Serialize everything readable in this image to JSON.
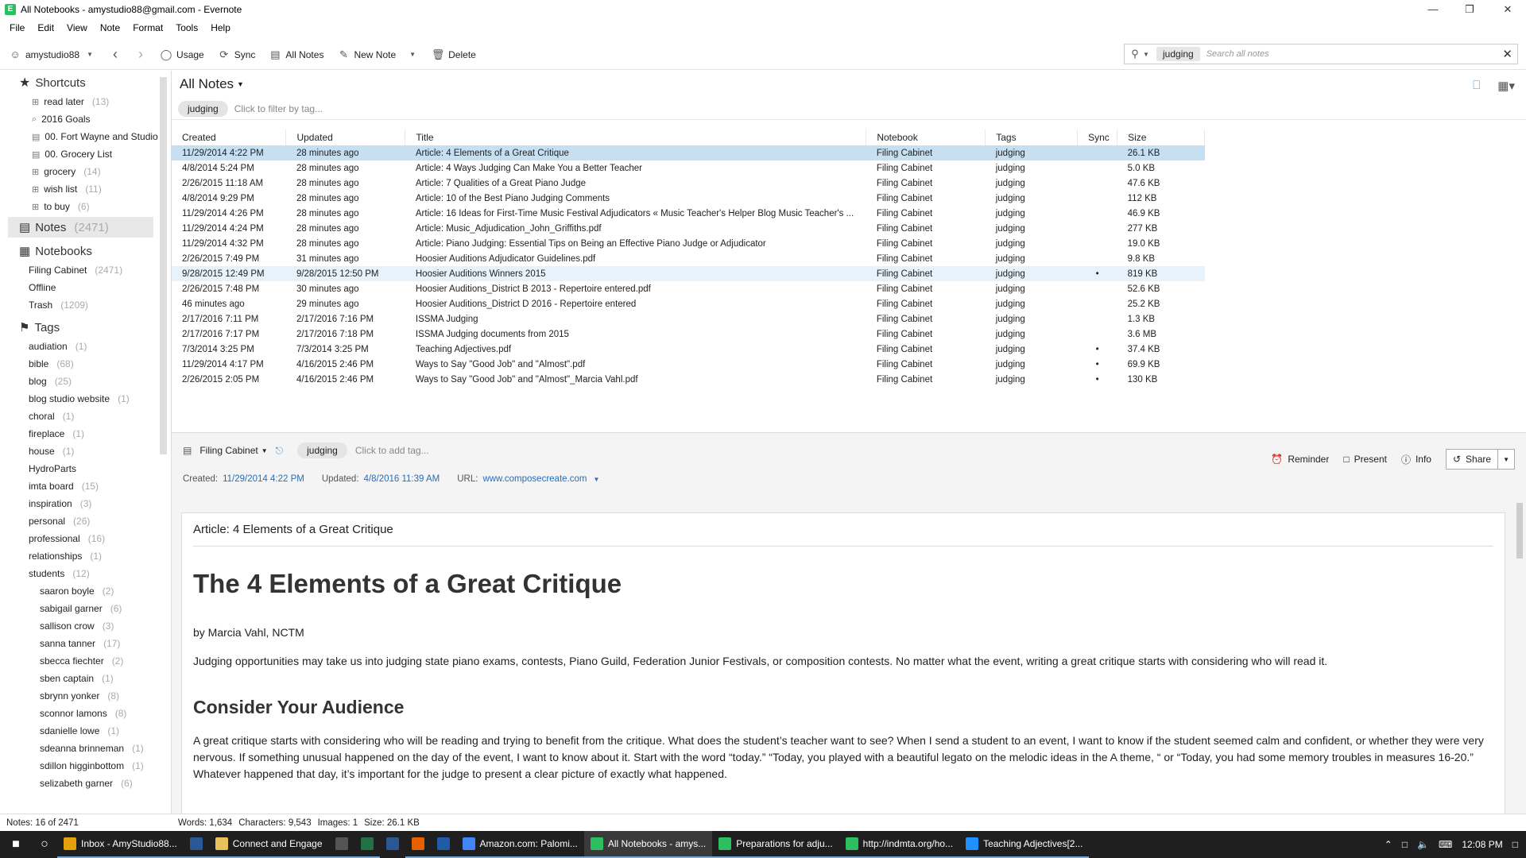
{
  "window": {
    "title": "All Notebooks - amystudio88@gmail.com - Evernote",
    "controls": [
      "minimize",
      "restore",
      "close"
    ]
  },
  "menu": [
    "File",
    "Edit",
    "View",
    "Note",
    "Format",
    "Tools",
    "Help"
  ],
  "toolbar": {
    "account": "amystudio88",
    "usage": "Usage",
    "sync": "Sync",
    "all_notes": "All Notes",
    "new_note": "New Note",
    "delete": "Delete",
    "search_token": "judging",
    "search_placeholder": "Search all notes"
  },
  "sidebar": {
    "shortcuts_label": "Shortcuts",
    "shortcuts": [
      {
        "label": "read later",
        "count": "(13)"
      },
      {
        "label": "2016 Goals",
        "count": ""
      },
      {
        "label": "00. Fort Wayne and Studio",
        "count": ""
      },
      {
        "label": "00. Grocery List",
        "count": ""
      },
      {
        "label": "grocery",
        "count": "(14)"
      },
      {
        "label": "wish list",
        "count": "(11)"
      },
      {
        "label": "to buy",
        "count": "(6)"
      }
    ],
    "notes_label": "Notes",
    "notes_count": "(2471)",
    "notebooks_label": "Notebooks",
    "notebooks": [
      {
        "label": "Filing Cabinet",
        "count": "(2471)"
      },
      {
        "label": "Offline",
        "count": ""
      },
      {
        "label": "Trash",
        "count": "(1209)"
      }
    ],
    "tags_label": "Tags",
    "tags": [
      {
        "label": "audiation",
        "count": "(1)"
      },
      {
        "label": "bible",
        "count": "(68)"
      },
      {
        "label": "blog",
        "count": "(25)"
      },
      {
        "label": "blog studio website",
        "count": "(1)"
      },
      {
        "label": "choral",
        "count": "(1)"
      },
      {
        "label": "fireplace",
        "count": "(1)"
      },
      {
        "label": "house",
        "count": "(1)"
      },
      {
        "label": "HydroParts",
        "count": ""
      },
      {
        "label": "imta board",
        "count": "(15)"
      },
      {
        "label": "inspiration",
        "count": "(3)"
      },
      {
        "label": "personal",
        "count": "(26)"
      },
      {
        "label": "professional",
        "count": "(16)"
      },
      {
        "label": "relationships",
        "count": "(1)"
      },
      {
        "label": "students",
        "count": "(12)"
      }
    ],
    "student_tags": [
      {
        "label": "saaron boyle",
        "count": "(2)"
      },
      {
        "label": "sabigail garner",
        "count": "(6)"
      },
      {
        "label": "sallison crow",
        "count": "(3)"
      },
      {
        "label": "sanna tanner",
        "count": "(17)"
      },
      {
        "label": "sbecca fiechter",
        "count": "(2)"
      },
      {
        "label": "sben captain",
        "count": "(1)"
      },
      {
        "label": "sbrynn yonker",
        "count": "(8)"
      },
      {
        "label": "sconnor lamons",
        "count": "(8)"
      },
      {
        "label": "sdanielle lowe",
        "count": "(1)"
      },
      {
        "label": "sdeanna brinneman",
        "count": "(1)"
      },
      {
        "label": "sdillon higginbottom",
        "count": "(1)"
      },
      {
        "label": "selizabeth garner",
        "count": "(6)"
      }
    ]
  },
  "notelist": {
    "title": "All Notes",
    "filter_chip": "judging",
    "filter_hint": "Click to filter by tag...",
    "columns": [
      "Created",
      "Updated",
      "Title",
      "Notebook",
      "Tags",
      "Sync",
      "Size"
    ],
    "rows": [
      [
        "11/29/2014 4:22 PM",
        "28 minutes ago",
        "Article: 4 Elements of a Great Critique",
        "Filing Cabinet",
        "judging",
        "",
        "26.1 KB"
      ],
      [
        "4/8/2014 5:24 PM",
        "28 minutes ago",
        "Article: 4 Ways Judging Can Make You a Better Teacher",
        "Filing Cabinet",
        "judging",
        "",
        "5.0 KB"
      ],
      [
        "2/26/2015 11:18 AM",
        "28 minutes ago",
        "Article: 7 Qualities of a Great Piano Judge",
        "Filing Cabinet",
        "judging",
        "",
        "47.6 KB"
      ],
      [
        "4/8/2014 9:29 PM",
        "28 minutes ago",
        "Article: 10 of the Best Piano Judging Comments",
        "Filing Cabinet",
        "judging",
        "",
        "112 KB"
      ],
      [
        "11/29/2014 4:26 PM",
        "28 minutes ago",
        "Article: 16 Ideas for First-Time Music Festival Adjudicators « Music Teacher's Helper Blog Music Teacher's ...",
        "Filing Cabinet",
        "judging",
        "",
        "46.9 KB"
      ],
      [
        "11/29/2014 4:24 PM",
        "28 minutes ago",
        "Article: Music_Adjudication_John_Griffiths.pdf",
        "Filing Cabinet",
        "judging",
        "",
        "277 KB"
      ],
      [
        "11/29/2014 4:32 PM",
        "28 minutes ago",
        "Article: Piano Judging: Essential Tips on Being an Effective Piano Judge or Adjudicator",
        "Filing Cabinet",
        "judging",
        "",
        "19.0 KB"
      ],
      [
        "2/26/2015 7:49 PM",
        "31 minutes ago",
        "Hoosier Auditions Adjudicator Guidelines.pdf",
        "Filing Cabinet",
        "judging",
        "",
        "9.8 KB"
      ],
      [
        "9/28/2015 12:49 PM",
        "9/28/2015 12:50 PM",
        "Hoosier Auditions Winners 2015",
        "Filing Cabinet",
        "judging",
        "•",
        "819 KB"
      ],
      [
        "2/26/2015 7:48 PM",
        "30 minutes ago",
        "Hoosier Auditions_District B 2013 - Repertoire entered.pdf",
        "Filing Cabinet",
        "judging",
        "",
        "52.6 KB"
      ],
      [
        "46 minutes ago",
        "29 minutes ago",
        "Hoosier Auditions_District D 2016 - Repertoire entered",
        "Filing Cabinet",
        "judging",
        "",
        "25.2 KB"
      ],
      [
        "2/17/2016 7:11 PM",
        "2/17/2016 7:16 PM",
        "ISSMA Judging",
        "Filing Cabinet",
        "judging",
        "",
        "1.3 KB"
      ],
      [
        "2/17/2016 7:17 PM",
        "2/17/2016 7:18 PM",
        "ISSMA Judging documents from 2015",
        "Filing Cabinet",
        "judging",
        "",
        "3.6 MB"
      ],
      [
        "7/3/2014 3:25 PM",
        "7/3/2014 3:25 PM",
        "Teaching Adjectives.pdf",
        "Filing Cabinet",
        "judging",
        "•",
        "37.4 KB"
      ],
      [
        "11/29/2014 4:17 PM",
        "4/16/2015 2:46 PM",
        "Ways to Say \"Good Job\" and \"Almost\".pdf",
        "Filing Cabinet",
        "judging",
        "•",
        "69.9 KB"
      ],
      [
        "2/26/2015 2:05 PM",
        "4/16/2015 2:46 PM",
        "Ways to Say \"Good Job\" and \"Almost\"_Marcia Vahl.pdf",
        "Filing Cabinet",
        "judging",
        "•",
        "130 KB"
      ]
    ]
  },
  "editor": {
    "notebook": "Filing Cabinet",
    "tag": "judging",
    "tag_hint": "Click to add tag...",
    "reminder": "Reminder",
    "present": "Present",
    "info": "Info",
    "share": "Share",
    "created_label": "Created:",
    "created": "11/29/2014 4:22 PM",
    "updated_label": "Updated:",
    "updated": "4/8/2016 11:39 AM",
    "url_label": "URL:",
    "url": "www.composecreate.com",
    "note_title": "Article: 4 Elements of a Great Critique",
    "h1": "The 4 Elements of a Great Critique",
    "byline": "by Marcia Vahl, NCTM",
    "p1": "Judging opportunities may take us into judging state piano exams, contests, Piano Guild, Federation Junior Festivals, or composition contests. No matter what the event, writing a great critique starts with considering who will read it.",
    "h2": "Consider Your Audience",
    "p2": "A great critique starts with considering who will be reading and trying to benefit from the critique. What does the student’s teacher want to see? When I send a student to an event, I want to know if the student seemed calm and confident, or whether they were very nervous. If something unusual happened on the day of the event, I want to know about it. Start with the word “today.” “Today, you played with a beautiful legato on the melodic ideas in the A theme, “ or “Today, you had some memory troubles in measures 16-20.” Whatever happened that day, it’s important for the judge to present a clear picture of exactly what happened."
  },
  "status": {
    "notes": "Notes: 16 of 2471",
    "words": "Words: 1,634",
    "characters": "Characters: 9,543",
    "images": "Images: 1",
    "size": "Size: 26.1 KB"
  },
  "taskbar": {
    "tasks": [
      {
        "label": "Inbox - AmyStudio88...",
        "icon": "mail-icon",
        "color": "#e5a00d"
      },
      {
        "label": "",
        "icon": "word-icon",
        "color": "#2b5797"
      },
      {
        "label": "Connect and Engage",
        "icon": "folder-icon",
        "color": "#e8c15a"
      },
      {
        "label": "",
        "icon": "calculator-icon",
        "color": "#555555"
      },
      {
        "label": "",
        "icon": "excel-icon",
        "color": "#217346"
      },
      {
        "label": "",
        "icon": "word-icon",
        "color": "#2b5797"
      },
      {
        "label": "",
        "icon": "firefox-icon",
        "color": "#e66000"
      },
      {
        "label": "",
        "icon": "app-icon",
        "color": "#1e5ba8"
      },
      {
        "label": "Amazon.com: Palomi...",
        "icon": "chrome-icon",
        "color": "#4285f4"
      },
      {
        "label": "All Notebooks - amys...",
        "icon": "evernote-icon",
        "color": "#2dbe60"
      },
      {
        "label": "Preparations for adju...",
        "icon": "evernote-icon",
        "color": "#2dbe60"
      },
      {
        "label": "http://indmta.org/ho...",
        "icon": "evernote-icon",
        "color": "#2dbe60"
      },
      {
        "label": "Teaching Adjectives[2...",
        "icon": "ie-icon",
        "color": "#1e90ff"
      }
    ],
    "clock": "12:08 PM"
  }
}
